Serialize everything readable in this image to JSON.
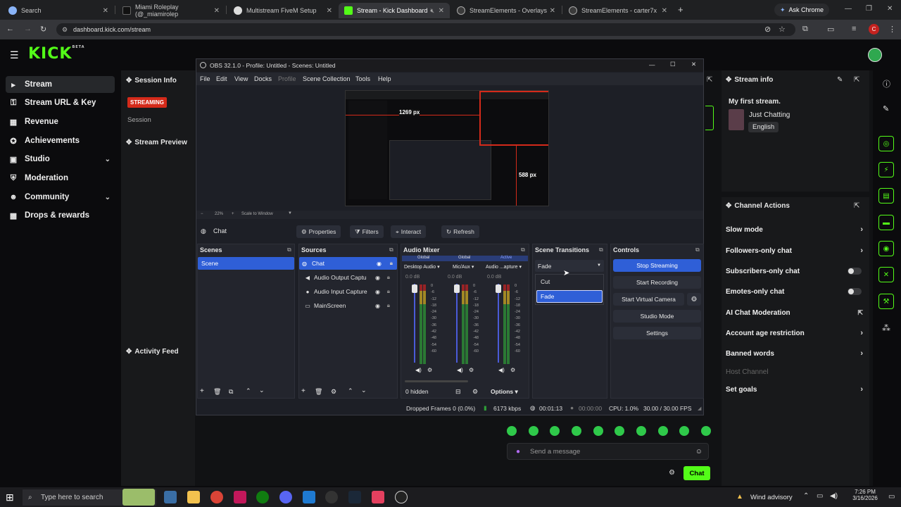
{
  "browser": {
    "tabs": [
      {
        "label": "Search",
        "color": "#9aa0a6"
      },
      {
        "label": "Miami Roleplay (@_miamirolep",
        "color": "#ffffff"
      },
      {
        "label": "Multistream FiveM Setup",
        "color": "#e0e0e0"
      },
      {
        "label": "Stream - Kick Dashboard",
        "color": "#53fc18"
      },
      {
        "label": "StreamElements - Overlays",
        "color": "#cfcfcf"
      },
      {
        "label": "StreamElements - carter7x",
        "color": "#cfcfcf"
      }
    ],
    "new_tab": "+",
    "ask_chrome": "Ask Chrome",
    "url": "dashboard.kick.com/stream",
    "profile_initial": "C"
  },
  "kick": {
    "logo": "KICK",
    "logo_sup": "BETA",
    "nav": [
      {
        "label": "Stream",
        "icon": "play-icon",
        "glyph": "▸",
        "active": true
      },
      {
        "label": "Stream URL & Key",
        "icon": "key-icon",
        "glyph": "⚿"
      },
      {
        "label": "Revenue",
        "icon": "revenue-icon",
        "glyph": "▦"
      },
      {
        "label": "Achievements",
        "icon": "trophy-icon",
        "glyph": "✪"
      },
      {
        "label": "Studio",
        "icon": "studio-icon",
        "glyph": "▣",
        "chevron": "⌄"
      },
      {
        "label": "Moderation",
        "icon": "shield-icon",
        "glyph": "⛨"
      },
      {
        "label": "Community",
        "icon": "users-icon",
        "glyph": "☻",
        "chevron": "⌄"
      },
      {
        "label": "Drops & rewards",
        "icon": "gift-icon",
        "glyph": "▩"
      }
    ],
    "session": {
      "title": "Session Info",
      "status": "STREAMING",
      "session_label": "Session",
      "preview_title": "Stream Preview",
      "activity_title": "Activity Feed"
    },
    "stream_info": {
      "title": "Stream info",
      "stream_title": "My first stream.",
      "category": "Just Chatting",
      "language": "English"
    },
    "channel_actions": {
      "title": "Channel Actions",
      "rows": [
        {
          "label": "Slow mode",
          "control": "chevron"
        },
        {
          "label": "Followers-only chat",
          "control": "chevron"
        },
        {
          "label": "Subscribers-only chat",
          "control": "toggle"
        },
        {
          "label": "Emotes-only chat",
          "control": "toggle"
        },
        {
          "label": "AI Chat Moderation",
          "control": "external"
        },
        {
          "label": "Account age restriction",
          "control": "chevron"
        },
        {
          "label": "Banned words",
          "control": "chevron"
        },
        {
          "label": "Host Channel",
          "control": "none",
          "disabled": true
        },
        {
          "label": "Set goals",
          "control": "chevron"
        }
      ]
    },
    "chat": {
      "placeholder": "Send a message",
      "send_label": "Chat"
    }
  },
  "obs": {
    "title": "OBS 32.1.0 - Profile: Untitled - Scenes: Untitled",
    "menu": [
      "File",
      "Edit",
      "View",
      "Docks",
      "Profile",
      "Scene Collection",
      "Tools",
      "Help"
    ],
    "preview_labels": {
      "width": "1269 px",
      "height": "588 px"
    },
    "zoom": "22%",
    "zoom_mode": "Scale to Window",
    "source_name": "Chat",
    "source_buttons": [
      "Properties",
      "Filters",
      "Interact",
      "Refresh"
    ],
    "docks": {
      "scenes": {
        "title": "Scenes",
        "items": [
          "Scene"
        ]
      },
      "sources": {
        "title": "Sources",
        "items": [
          {
            "name": "Chat",
            "icon": "browser-icon",
            "selected": true
          },
          {
            "name": "Audio Output Captu",
            "icon": "speaker-icon"
          },
          {
            "name": "Audio Input Capture",
            "icon": "mic-icon"
          },
          {
            "name": "MainScreen",
            "icon": "monitor-icon"
          }
        ]
      },
      "audio_mixer": {
        "title": "Audio Mixer",
        "channels": [
          {
            "tag": "Global",
            "name": "Desktop Audio",
            "db": "0.0 dB"
          },
          {
            "tag": "Global",
            "name": "Mic/Aux",
            "db": "0.0 dB"
          },
          {
            "tag": "Active",
            "name": "Audio ...apture",
            "db": "0.0 dB"
          }
        ],
        "scale": [
          "0",
          "-6",
          "-12",
          "-18",
          "-24",
          "-30",
          "-36",
          "-42",
          "-48",
          "-54",
          "-60"
        ],
        "hidden": "0 hidden",
        "options": "Options"
      },
      "transitions": {
        "title": "Scene Transitions",
        "selected": "Fade",
        "options": [
          "Cut",
          "Fade"
        ]
      },
      "controls": {
        "title": "Controls",
        "buttons": [
          "Stop Streaming",
          "Start Recording",
          "Start Virtual Camera",
          "Studio Mode",
          "Settings"
        ]
      }
    },
    "status": {
      "dropped": "Dropped Frames 0 (0.0%)",
      "bitrate": "6173 kbps",
      "stream_time": "00:01:13",
      "rec_time": "00:00:00",
      "cpu": "CPU: 1.0%",
      "fps": "30.00 / 30.00 FPS"
    }
  },
  "taskbar": {
    "search_placeholder": "Type here to search",
    "weather": "Wind advisory",
    "time": "7:26 PM",
    "date": "3/16/2026"
  },
  "colors": {
    "kick_green": "#53fc18",
    "obs_blue": "#2f5fd7",
    "live_red": "#d42a1a"
  }
}
